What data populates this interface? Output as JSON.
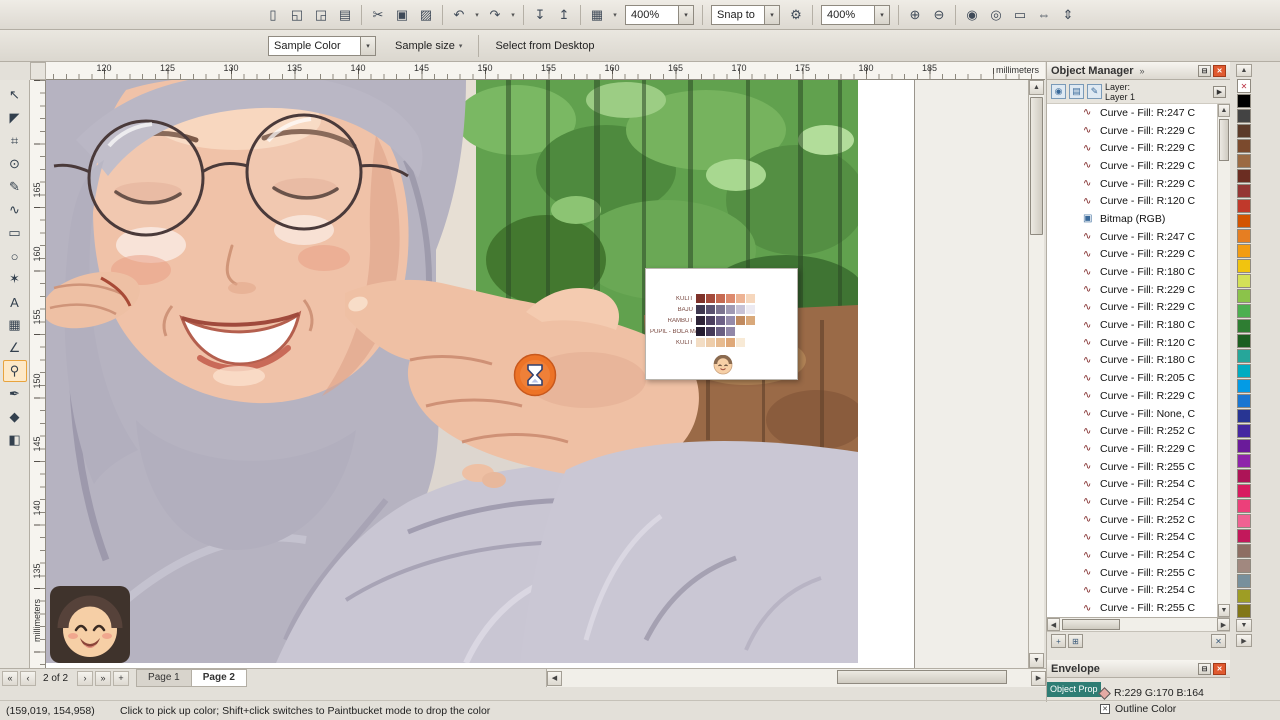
{
  "glyphs": {
    "chevron_down": "▾",
    "arrow_up": "▲",
    "arrow_down": "▼",
    "arrow_left": "◀",
    "arrow_right": "▶",
    "first_page": "«",
    "prev_page": "‹",
    "next_page": "›",
    "last_page": "»",
    "add_page": "+",
    "flyout": "»",
    "layer_flyout": "▶",
    "close": "✕",
    "rollup": "⊟",
    "no_color": "✕",
    "curve_icon": "∿",
    "bitmap_icon": "▣",
    "eye_icon": "◉",
    "print_icon": "▤",
    "edit_icon": "✎",
    "new_layer": "+",
    "new_master_layer": "⊞",
    "delete_layer": "✕",
    "outline_x": "✕"
  },
  "toolbar": {
    "items": [
      {
        "type": "icon",
        "name": "new-document",
        "glyph": "▯"
      },
      {
        "type": "icon",
        "name": "open-document",
        "glyph": "◱"
      },
      {
        "type": "icon",
        "name": "save-document",
        "glyph": "◲"
      },
      {
        "type": "icon",
        "name": "print",
        "glyph": "▤"
      },
      {
        "type": "sep"
      },
      {
        "type": "icon",
        "name": "cut",
        "glyph": "✂"
      },
      {
        "type": "icon",
        "name": "copy",
        "glyph": "▣"
      },
      {
        "type": "icon",
        "name": "paste",
        "glyph": "▨"
      },
      {
        "type": "sep"
      },
      {
        "type": "icondrop",
        "name": "undo",
        "glyph": "↶"
      },
      {
        "type": "icondrop",
        "name": "redo",
        "glyph": "↷"
      },
      {
        "type": "sep"
      },
      {
        "type": "icon",
        "name": "import",
        "glyph": "↧"
      },
      {
        "type": "icon",
        "name": "export",
        "glyph": "↥"
      },
      {
        "type": "sep"
      },
      {
        "type": "icondrop",
        "name": "application-launcher",
        "glyph": "▦"
      },
      {
        "type": "combo",
        "name": "zoom-levels",
        "value": "400%"
      },
      {
        "type": "sep"
      },
      {
        "type": "combo",
        "name": "snap-to",
        "value": "Snap to"
      },
      {
        "type": "icon",
        "name": "options",
        "glyph": "⚙"
      },
      {
        "type": "sep"
      },
      {
        "type": "combo",
        "name": "zoom-level",
        "value": "400%"
      },
      {
        "type": "sep"
      },
      {
        "type": "icon",
        "name": "zoom-in",
        "glyph": "⊕"
      },
      {
        "type": "icon",
        "name": "zoom-out",
        "glyph": "⊖"
      },
      {
        "type": "sep"
      },
      {
        "type": "icon",
        "name": "zoom-selected",
        "glyph": "◉"
      },
      {
        "type": "icon",
        "name": "zoom-all-objects",
        "glyph": "◎"
      },
      {
        "type": "icon",
        "name": "zoom-to-page",
        "glyph": "▭"
      },
      {
        "type": "icon",
        "name": "zoom-to-width",
        "glyph": "⇔"
      },
      {
        "type": "icon",
        "name": "zoom-to-height",
        "glyph": "⇕"
      }
    ]
  },
  "property_bar": {
    "sample_color": "Sample Color",
    "sample_size": "Sample size",
    "select_from_desktop": "Select from Desktop"
  },
  "rulers": {
    "horizontal_ticks": [
      "120",
      "125",
      "130",
      "135",
      "140",
      "145",
      "150",
      "155",
      "160",
      "165",
      "170",
      "175",
      "180",
      "185"
    ],
    "vertical_ticks": [
      "165",
      "160",
      "155",
      "150",
      "145",
      "140",
      "135"
    ],
    "unit": "millimeters"
  },
  "toolbox": {
    "tools": [
      {
        "name": "pick-tool",
        "glyph": "↖"
      },
      {
        "name": "shape-tool",
        "glyph": "◤"
      },
      {
        "name": "crop-tool",
        "glyph": "⌗"
      },
      {
        "name": "zoom-tool",
        "glyph": "⊙"
      },
      {
        "name": "freehand-tool",
        "glyph": "✎"
      },
      {
        "name": "artistic-media-tool",
        "glyph": "∿"
      },
      {
        "name": "rectangle-tool",
        "glyph": "▭"
      },
      {
        "name": "ellipse-tool",
        "glyph": "○"
      },
      {
        "name": "polygon-tool",
        "glyph": "✶"
      },
      {
        "name": "text-tool",
        "glyph": "A"
      },
      {
        "name": "table-tool",
        "glyph": "▦"
      },
      {
        "name": "dimension-tool",
        "glyph": "∠"
      },
      {
        "name": "color-eyedropper-tool",
        "glyph": "⚲",
        "active": true
      },
      {
        "name": "outline-pen-tool",
        "glyph": "✒"
      },
      {
        "name": "fill-tool",
        "glyph": "◆"
      },
      {
        "name": "interactive-fill-tool",
        "glyph": "◧"
      }
    ]
  },
  "object_manager": {
    "title": "Object Manager",
    "layer_label": "Layer:",
    "layer_name": "Layer 1",
    "items": [
      {
        "type": "curve",
        "label": "Curve - Fill: R:247 C"
      },
      {
        "type": "curve",
        "label": "Curve - Fill: R:229 C"
      },
      {
        "type": "curve",
        "label": "Curve - Fill: R:229 C"
      },
      {
        "type": "curve",
        "label": "Curve - Fill: R:229 C"
      },
      {
        "type": "curve",
        "label": "Curve - Fill: R:229 C"
      },
      {
        "type": "curve",
        "label": "Curve - Fill: R:120 C"
      },
      {
        "type": "bitmap",
        "label": "Bitmap (RGB)"
      },
      {
        "type": "curve",
        "label": "Curve - Fill: R:247 C"
      },
      {
        "type": "curve",
        "label": "Curve - Fill: R:229 C"
      },
      {
        "type": "curve",
        "label": "Curve - Fill: R:180 C"
      },
      {
        "type": "curve",
        "label": "Curve - Fill: R:229 C"
      },
      {
        "type": "curve",
        "label": "Curve - Fill: R:229 C"
      },
      {
        "type": "curve",
        "label": "Curve - Fill: R:180 C"
      },
      {
        "type": "curve",
        "label": "Curve - Fill: R:120 C"
      },
      {
        "type": "curve",
        "label": "Curve - Fill: R:180 C"
      },
      {
        "type": "curve",
        "label": "Curve - Fill: R:205 C"
      },
      {
        "type": "curve",
        "label": "Curve - Fill: R:229 C"
      },
      {
        "type": "curve",
        "label": "Curve - Fill: None, C"
      },
      {
        "type": "curve",
        "label": "Curve - Fill: R:252 C"
      },
      {
        "type": "curve",
        "label": "Curve - Fill: R:229 C"
      },
      {
        "type": "curve",
        "label": "Curve - Fill: R:255 C"
      },
      {
        "type": "curve",
        "label": "Curve - Fill: R:254 C"
      },
      {
        "type": "curve",
        "label": "Curve - Fill: R:254 C"
      },
      {
        "type": "curve",
        "label": "Curve - Fill: R:252 C"
      },
      {
        "type": "curve",
        "label": "Curve - Fill: R:254 C"
      },
      {
        "type": "curve",
        "label": "Curve - Fill: R:254 C"
      },
      {
        "type": "curve",
        "label": "Curve - Fill: R:255 C"
      },
      {
        "type": "curve",
        "label": "Curve - Fill: R:254 C"
      },
      {
        "type": "curve",
        "label": "Curve - Fill: R:255 C"
      }
    ]
  },
  "envelope_docker": {
    "title": "Envelope"
  },
  "object_properties_docker": {
    "title": "Object Prop"
  },
  "navigator": {
    "page_info": "2 of 2",
    "tabs": [
      "Page 1",
      "Page 2"
    ],
    "active_tab": "Page 2"
  },
  "status_bar": {
    "coordinates": "(159,019, 154,958)",
    "hint": "Click to pick up color; Shift+click switches to Paintbucket mode to drop the color",
    "fill_color_text": "R:229 G:170 B:164",
    "fill_color_hex": "#E5AAA4",
    "outline_label": "Outline Color"
  },
  "color_palette": {
    "colors": [
      "none",
      "#000000",
      "#434343",
      "#5b3a29",
      "#7b4a2d",
      "#9b6a43",
      "#6b2d22",
      "#943634",
      "#c0392b",
      "#d35400",
      "#e67e22",
      "#f39c12",
      "#f1c40f",
      "#d4e157",
      "#8bc34a",
      "#4caf50",
      "#2e7d32",
      "#1b5e20",
      "#26a69a",
      "#00acc1",
      "#039be5",
      "#1976d2",
      "#283593",
      "#4527a0",
      "#6a1b9a",
      "#8e24aa",
      "#ad1457",
      "#d81b60",
      "#ec407a",
      "#f06292",
      "#c2185b",
      "#8d6e63",
      "#a1887f",
      "#78909c",
      "#9e9d24",
      "#827717"
    ]
  },
  "palette_card": {
    "rows": [
      {
        "label": "KULIT",
        "swatches": [
          "#7e322a",
          "#a44b3c",
          "#c66a52",
          "#dd8a6e",
          "#edb394",
          "#f6d7bd"
        ]
      },
      {
        "label": "BAJU",
        "swatches": [
          "#3f3850",
          "#5a5270",
          "#7d7591",
          "#a19ab4",
          "#c7c2d6",
          "#eceaf2"
        ]
      },
      {
        "label": "RAMBUT",
        "swatches": [
          "#2e2438",
          "#4c4060",
          "#6e6288",
          "#958bab",
          "#c08a5f",
          "#d9a97b"
        ]
      },
      {
        "label": "PUPIL - BOLA MATA",
        "swatches": [
          "#241c30",
          "#453a58",
          "#6a5f82",
          "#9187a8"
        ]
      },
      {
        "label": "KULIT",
        "swatches": [
          "#f3ddc4",
          "#eecdaa",
          "#e7bb90",
          "#dfa878",
          "#f8ead6"
        ]
      }
    ]
  }
}
